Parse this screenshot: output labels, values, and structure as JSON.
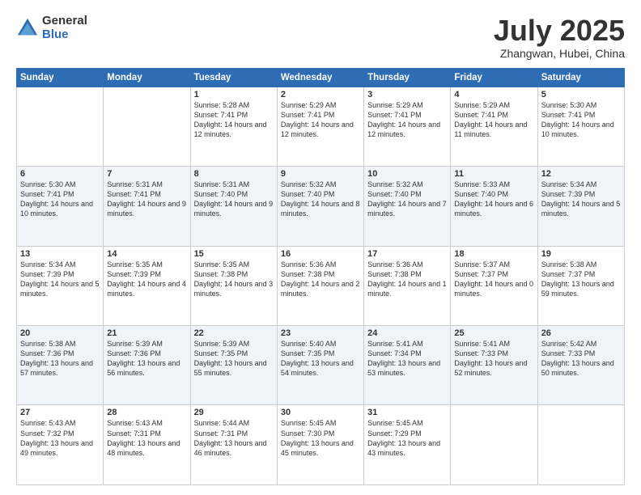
{
  "logo": {
    "general": "General",
    "blue": "Blue"
  },
  "header": {
    "month": "July 2025",
    "location": "Zhangwan, Hubei, China"
  },
  "weekdays": [
    "Sunday",
    "Monday",
    "Tuesday",
    "Wednesday",
    "Thursday",
    "Friday",
    "Saturday"
  ],
  "weeks": [
    [
      {
        "day": "",
        "info": ""
      },
      {
        "day": "",
        "info": ""
      },
      {
        "day": "1",
        "info": "Sunrise: 5:28 AM\nSunset: 7:41 PM\nDaylight: 14 hours and 12 minutes."
      },
      {
        "day": "2",
        "info": "Sunrise: 5:29 AM\nSunset: 7:41 PM\nDaylight: 14 hours and 12 minutes."
      },
      {
        "day": "3",
        "info": "Sunrise: 5:29 AM\nSunset: 7:41 PM\nDaylight: 14 hours and 12 minutes."
      },
      {
        "day": "4",
        "info": "Sunrise: 5:29 AM\nSunset: 7:41 PM\nDaylight: 14 hours and 11 minutes."
      },
      {
        "day": "5",
        "info": "Sunrise: 5:30 AM\nSunset: 7:41 PM\nDaylight: 14 hours and 10 minutes."
      }
    ],
    [
      {
        "day": "6",
        "info": "Sunrise: 5:30 AM\nSunset: 7:41 PM\nDaylight: 14 hours and 10 minutes."
      },
      {
        "day": "7",
        "info": "Sunrise: 5:31 AM\nSunset: 7:41 PM\nDaylight: 14 hours and 9 minutes."
      },
      {
        "day": "8",
        "info": "Sunrise: 5:31 AM\nSunset: 7:40 PM\nDaylight: 14 hours and 9 minutes."
      },
      {
        "day": "9",
        "info": "Sunrise: 5:32 AM\nSunset: 7:40 PM\nDaylight: 14 hours and 8 minutes."
      },
      {
        "day": "10",
        "info": "Sunrise: 5:32 AM\nSunset: 7:40 PM\nDaylight: 14 hours and 7 minutes."
      },
      {
        "day": "11",
        "info": "Sunrise: 5:33 AM\nSunset: 7:40 PM\nDaylight: 14 hours and 6 minutes."
      },
      {
        "day": "12",
        "info": "Sunrise: 5:34 AM\nSunset: 7:39 PM\nDaylight: 14 hours and 5 minutes."
      }
    ],
    [
      {
        "day": "13",
        "info": "Sunrise: 5:34 AM\nSunset: 7:39 PM\nDaylight: 14 hours and 5 minutes."
      },
      {
        "day": "14",
        "info": "Sunrise: 5:35 AM\nSunset: 7:39 PM\nDaylight: 14 hours and 4 minutes."
      },
      {
        "day": "15",
        "info": "Sunrise: 5:35 AM\nSunset: 7:38 PM\nDaylight: 14 hours and 3 minutes."
      },
      {
        "day": "16",
        "info": "Sunrise: 5:36 AM\nSunset: 7:38 PM\nDaylight: 14 hours and 2 minutes."
      },
      {
        "day": "17",
        "info": "Sunrise: 5:36 AM\nSunset: 7:38 PM\nDaylight: 14 hours and 1 minute."
      },
      {
        "day": "18",
        "info": "Sunrise: 5:37 AM\nSunset: 7:37 PM\nDaylight: 14 hours and 0 minutes."
      },
      {
        "day": "19",
        "info": "Sunrise: 5:38 AM\nSunset: 7:37 PM\nDaylight: 13 hours and 59 minutes."
      }
    ],
    [
      {
        "day": "20",
        "info": "Sunrise: 5:38 AM\nSunset: 7:36 PM\nDaylight: 13 hours and 57 minutes."
      },
      {
        "day": "21",
        "info": "Sunrise: 5:39 AM\nSunset: 7:36 PM\nDaylight: 13 hours and 56 minutes."
      },
      {
        "day": "22",
        "info": "Sunrise: 5:39 AM\nSunset: 7:35 PM\nDaylight: 13 hours and 55 minutes."
      },
      {
        "day": "23",
        "info": "Sunrise: 5:40 AM\nSunset: 7:35 PM\nDaylight: 13 hours and 54 minutes."
      },
      {
        "day": "24",
        "info": "Sunrise: 5:41 AM\nSunset: 7:34 PM\nDaylight: 13 hours and 53 minutes."
      },
      {
        "day": "25",
        "info": "Sunrise: 5:41 AM\nSunset: 7:33 PM\nDaylight: 13 hours and 52 minutes."
      },
      {
        "day": "26",
        "info": "Sunrise: 5:42 AM\nSunset: 7:33 PM\nDaylight: 13 hours and 50 minutes."
      }
    ],
    [
      {
        "day": "27",
        "info": "Sunrise: 5:43 AM\nSunset: 7:32 PM\nDaylight: 13 hours and 49 minutes."
      },
      {
        "day": "28",
        "info": "Sunrise: 5:43 AM\nSunset: 7:31 PM\nDaylight: 13 hours and 48 minutes."
      },
      {
        "day": "29",
        "info": "Sunrise: 5:44 AM\nSunset: 7:31 PM\nDaylight: 13 hours and 46 minutes."
      },
      {
        "day": "30",
        "info": "Sunrise: 5:45 AM\nSunset: 7:30 PM\nDaylight: 13 hours and 45 minutes."
      },
      {
        "day": "31",
        "info": "Sunrise: 5:45 AM\nSunset: 7:29 PM\nDaylight: 13 hours and 43 minutes."
      },
      {
        "day": "",
        "info": ""
      },
      {
        "day": "",
        "info": ""
      }
    ]
  ]
}
